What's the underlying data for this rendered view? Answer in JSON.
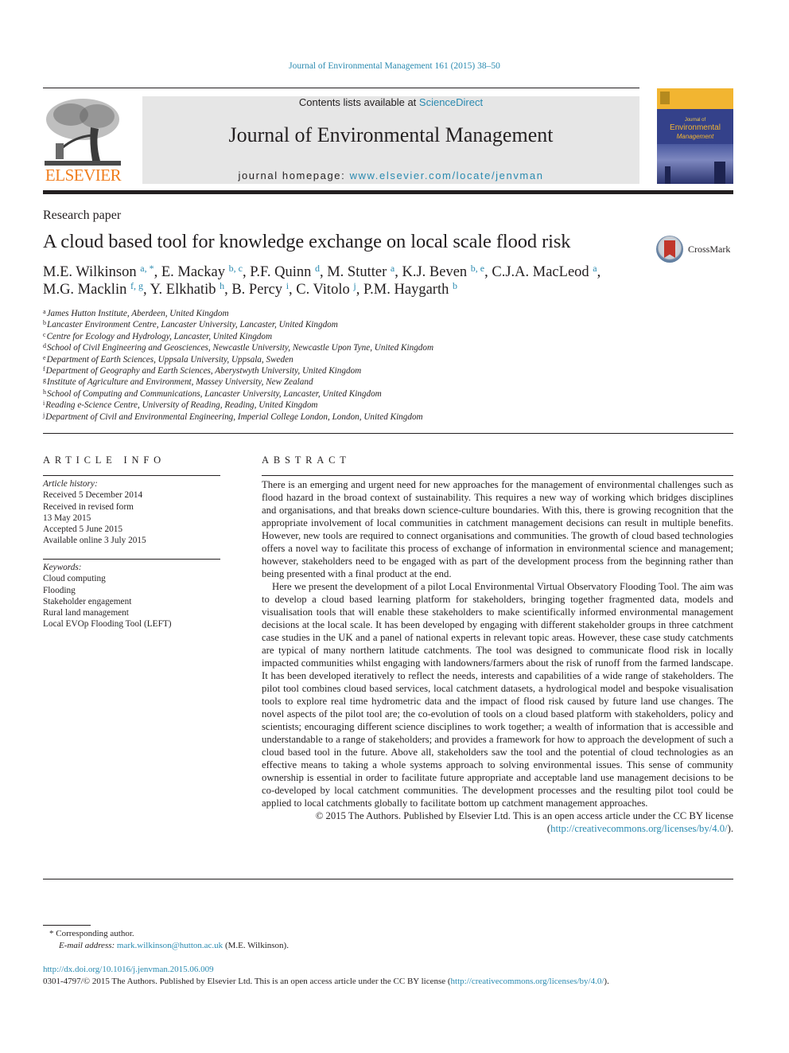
{
  "header": {
    "citation": "Journal of Environmental Management 161 (2015) 38–50",
    "contents_prefix": "Contents lists available at ",
    "contents_link": "ScienceDirect",
    "journal_title": "Journal of Environmental Management",
    "homepage_prefix": "journal homepage: ",
    "homepage_link": "www.elsevier.com/locate/jenvman",
    "publisher_logo_text": "ELSEVIER",
    "cover": {
      "small_text": "Journal of",
      "title_line_1": "Environmental",
      "title_line_2": "Management"
    }
  },
  "article": {
    "type": "Research paper",
    "title": "A cloud based tool for knowledge exchange on local scale flood risk",
    "crossmark_label": "CrossMark",
    "authors": [
      {
        "name": "M.E. Wilkinson",
        "sup": "a, *",
        "sep": ", "
      },
      {
        "name": "E. Mackay",
        "sup": "b, c",
        "sep": ", "
      },
      {
        "name": "P.F. Quinn",
        "sup": "d",
        "sep": ", "
      },
      {
        "name": "M. Stutter",
        "sup": "a",
        "sep": ", "
      },
      {
        "name": "K.J. Beven",
        "sup": "b, e",
        "sep": ", "
      },
      {
        "name": "C.J.A. MacLeod",
        "sup": "a",
        "sep": ","
      },
      {
        "name": "M.G. Macklin",
        "sup": "f, g",
        "sep": ", "
      },
      {
        "name": "Y. Elkhatib",
        "sup": "h",
        "sep": ", "
      },
      {
        "name": "B. Percy",
        "sup": "i",
        "sep": ", "
      },
      {
        "name": "C. Vitolo",
        "sup": "j",
        "sep": ", "
      },
      {
        "name": "P.M. Haygarth",
        "sup": "b",
        "sep": ""
      }
    ],
    "affiliations": [
      {
        "key": "a",
        "text": "James Hutton Institute, Aberdeen, United Kingdom"
      },
      {
        "key": "b",
        "text": "Lancaster Environment Centre, Lancaster University, Lancaster, United Kingdom"
      },
      {
        "key": "c",
        "text": "Centre for Ecology and Hydrology, Lancaster, United Kingdom"
      },
      {
        "key": "d",
        "text": "School of Civil Engineering and Geosciences, Newcastle University, Newcastle Upon Tyne, United Kingdom"
      },
      {
        "key": "e",
        "text": "Department of Earth Sciences, Uppsala University, Uppsala, Sweden"
      },
      {
        "key": "f",
        "text": "Department of Geography and Earth Sciences, Aberystwyth University, United Kingdom"
      },
      {
        "key": "g",
        "text": "Institute of Agriculture and Environment, Massey University, New Zealand"
      },
      {
        "key": "h",
        "text": "School of Computing and Communications, Lancaster University, Lancaster, United Kingdom"
      },
      {
        "key": "i",
        "text": "Reading e-Science Centre, University of Reading, Reading, United Kingdom"
      },
      {
        "key": "j",
        "text": "Department of Civil and Environmental Engineering, Imperial College London, London, United Kingdom"
      }
    ]
  },
  "article_info": {
    "heading": "ARTICLE INFO",
    "history_label": "Article history:",
    "history": [
      "Received 5 December 2014",
      "Received in revised form",
      "13 May 2015",
      "Accepted 5 June 2015",
      "Available online 3 July 2015"
    ],
    "keywords_label": "Keywords:",
    "keywords": [
      "Cloud computing",
      "Flooding",
      "Stakeholder engagement",
      "Rural land management",
      "Local EVOp Flooding Tool (LEFT)"
    ]
  },
  "abstract": {
    "heading": "ABSTRACT",
    "paragraph_1": "There is an emerging and urgent need for new approaches for the management of environmental challenges such as flood hazard in the broad context of sustainability. This requires a new way of working which bridges disciplines and organisations, and that breaks down science-culture boundaries. With this, there is growing recognition that the appropriate involvement of local communities in catchment management decisions can result in multiple benefits. However, new tools are required to connect organisations and communities. The growth of cloud based technologies offers a novel way to facilitate this process of exchange of information in environmental science and management; however, stakeholders need to be engaged with as part of the development process from the beginning rather than being presented with a final product at the end.",
    "paragraph_2": "Here we present the development of a pilot Local Environmental Virtual Observatory Flooding Tool. The aim was to develop a cloud based learning platform for stakeholders, bringing together fragmented data, models and visualisation tools that will enable these stakeholders to make scientifically informed environmental management decisions at the local scale. It has been developed by engaging with different stakeholder groups in three catchment case studies in the UK and a panel of national experts in relevant topic areas. However, these case study catchments are typical of many northern latitude catchments. The tool was designed to communicate flood risk in locally impacted communities whilst engaging with landowners/farmers about the risk of runoff from the farmed landscape. It has been developed iteratively to reflect the needs, interests and capabilities of a wide range of stakeholders. The pilot tool combines cloud based services, local catchment datasets, a hydrological model and bespoke visualisation tools to explore real time hydrometric data and the impact of flood risk caused by future land use changes. The novel aspects of the pilot tool are; the co-evolution of tools on a cloud based platform with stakeholders, policy and scientists; encouraging different science disciplines to work together; a wealth of information that is accessible and understandable to a range of stakeholders; and provides a framework for how to approach the development of such a cloud based tool in the future. Above all, stakeholders saw the tool and the potential of cloud technologies as an effective means to taking a whole systems approach to solving environmental issues. This sense of community ownership is essential in order to facilitate future appropriate and acceptable land use management decisions to be co-developed by local catchment communities. The development processes and the resulting pilot tool could be applied to local catchments globally to facilitate bottom up catchment management approaches.",
    "license_text": "© 2015 The Authors. Published by Elsevier Ltd. This is an open access article under the CC BY license",
    "license_link": "http://creativecommons.org/licenses/by/4.0/"
  },
  "footnotes": {
    "corresponding_marker": "*",
    "corresponding_text": "Corresponding author.",
    "email_label": "E-mail address:",
    "email": "mark.wilkinson@hutton.ac.uk",
    "email_owner": "(M.E. Wilkinson)."
  },
  "doi": {
    "link": "http://dx.doi.org/10.1016/j.jenvman.2015.06.009",
    "issn_text": "0301-4797/© 2015 The Authors. Published by Elsevier Ltd. This is an open access article under the CC BY license (",
    "license_link": "http://creativecommons.org/licenses/by/4.0/",
    "issn_suffix": ")."
  },
  "colors": {
    "link": "#2a8ab0",
    "elsevier_orange": "#f07e1e",
    "masthead_bg": "#e6e6e6",
    "cover_blue": "#34418a",
    "cover_yellow": "#f2b531"
  }
}
